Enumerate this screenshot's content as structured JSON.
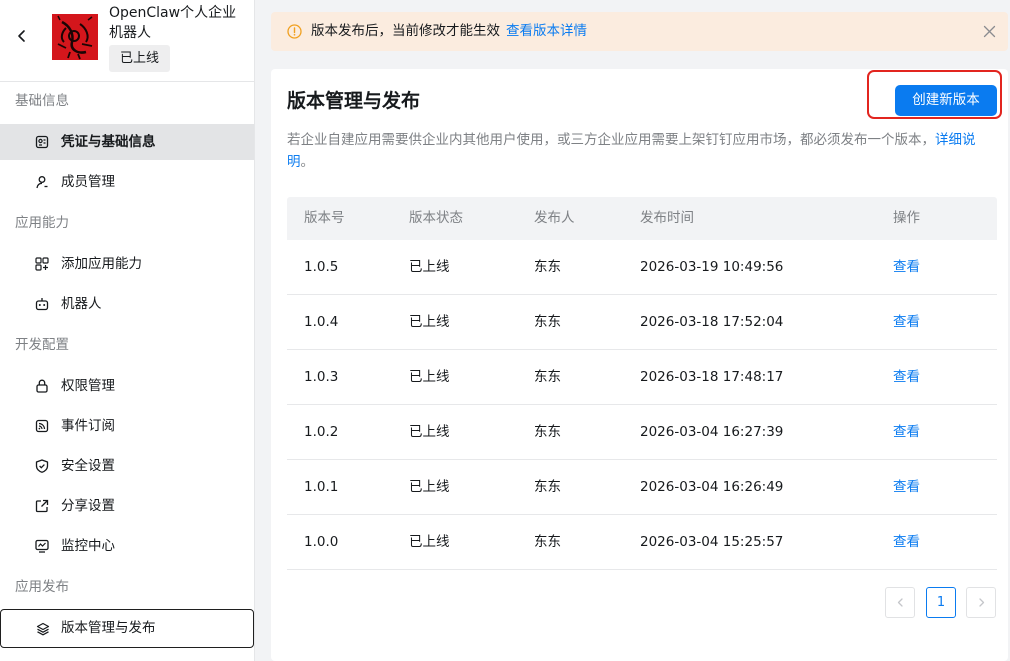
{
  "app": {
    "name": "OpenClaw个人企业机器人",
    "status": "已上线"
  },
  "sidebar": {
    "groups": [
      {
        "title": "基础信息",
        "items": [
          {
            "label": "凭证与基础信息",
            "icon": "credential-icon",
            "active": true
          },
          {
            "label": "成员管理",
            "icon": "user-icon"
          }
        ]
      },
      {
        "title": "应用能力",
        "items": [
          {
            "label": "添加应用能力",
            "icon": "apps-add-icon"
          },
          {
            "label": "机器人",
            "icon": "robot-icon"
          }
        ]
      },
      {
        "title": "开发配置",
        "items": [
          {
            "label": "权限管理",
            "icon": "lock-icon"
          },
          {
            "label": "事件订阅",
            "icon": "rss-icon"
          },
          {
            "label": "安全设置",
            "icon": "shield-icon"
          },
          {
            "label": "分享设置",
            "icon": "share-icon"
          },
          {
            "label": "监控中心",
            "icon": "monitor-icon"
          }
        ]
      },
      {
        "title": "应用发布",
        "items": [
          {
            "label": "版本管理与发布",
            "icon": "layers-icon",
            "outlined": true
          }
        ]
      }
    ]
  },
  "notice": {
    "text": "版本发布后，当前修改才能生效",
    "link": "查看版本详情"
  },
  "main": {
    "title": "版本管理与发布",
    "create_button": "创建新版本",
    "description": "若企业自建应用需要供企业内其他用户使用，或三方企业应用需要上架钉钉应用市场，都必须发布一个版本，",
    "description_link": "详细说明",
    "description_end": "。",
    "table": {
      "headers": [
        "版本号",
        "版本状态",
        "发布人",
        "发布时间",
        "操作"
      ],
      "rows": [
        {
          "version": "1.0.5",
          "status": "已上线",
          "publisher": "东东",
          "time": "2026-03-19 10:49:56",
          "action": "查看"
        },
        {
          "version": "1.0.4",
          "status": "已上线",
          "publisher": "东东",
          "time": "2026-03-18 17:52:04",
          "action": "查看"
        },
        {
          "version": "1.0.3",
          "status": "已上线",
          "publisher": "东东",
          "time": "2026-03-18 17:48:17",
          "action": "查看"
        },
        {
          "version": "1.0.2",
          "status": "已上线",
          "publisher": "东东",
          "time": "2026-03-04 16:27:39",
          "action": "查看"
        },
        {
          "version": "1.0.1",
          "status": "已上线",
          "publisher": "东东",
          "time": "2026-03-04 16:26:49",
          "action": "查看"
        },
        {
          "version": "1.0.0",
          "status": "已上线",
          "publisher": "东东",
          "time": "2026-03-04 15:25:57",
          "action": "查看"
        }
      ]
    },
    "pagination": {
      "current_page": "1"
    }
  },
  "colors": {
    "accent": "#0a7bf0",
    "notice_bg": "#fbecdf",
    "warning": "#f0a020",
    "highlight_border": "#e2251f"
  }
}
